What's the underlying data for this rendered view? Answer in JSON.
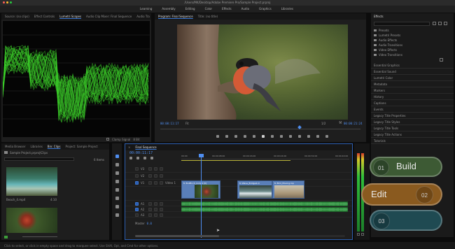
{
  "window_title": "/Users/MK/Desktop/Adobe Premiere Pro/Sample Project.prproj",
  "workspaces": [
    "Learning",
    "Assembly",
    "Editing",
    "Color",
    "Effects",
    "Audio",
    "Graphics",
    "Libraries"
  ],
  "source_tabs": [
    "Source: (no clips)",
    "Effect Controls",
    "Lumetri Scopes",
    "Audio Clip Mixer: Final Sequence",
    "Audio Tra"
  ],
  "source_active": 2,
  "scope_menu_label": "Clamp Signal",
  "scope_bit_label": "8 Bit",
  "program_tabs": [
    "Program: Final Sequence",
    "Title: (no title)"
  ],
  "program_timecode": "00:00:11:17",
  "program_fit": "Fit",
  "program_res": "1/2",
  "program_duration": "00:00:21:24",
  "project_tabs": [
    "Media Browser",
    "Libraries",
    "Bin: Clips",
    "Project: Sample Project"
  ],
  "project_active": 2,
  "project_path": "Sample Project.prproj\\Clips",
  "project_items_count": "6 Items",
  "clip1_name": "Beach_4.mp4",
  "clip1_duration": "4:10",
  "sequence_tab": "Final Sequence",
  "timeline_timecode": "00:00:11:17",
  "ruler_labels": [
    "00:00",
    "00:00:08:00",
    "00:00:16:00",
    "00:00:24:00",
    "00:00:32:00",
    "00:00:40:00"
  ],
  "tracks": [
    {
      "name": "V3",
      "label": ""
    },
    {
      "name": "V2",
      "label": ""
    },
    {
      "name": "V1",
      "label": "Video 1"
    },
    {
      "name": "A1",
      "label": ""
    },
    {
      "name": "A2",
      "label": ""
    },
    {
      "name": "A3",
      "label": ""
    }
  ],
  "master_label": "Master",
  "master_value": "0.0",
  "clip_labels": [
    "fx  Bullfinch_4.mp4 [V]",
    "fx  Wave_Bridge4.m",
    "fx  Bird_Moving.mp"
  ],
  "effects_title": "Effects",
  "effects_tree": [
    "Presets",
    "Lumetri Presets",
    "Audio Effects",
    "Audio Transitions",
    "Video Effects",
    "Video Transitions"
  ],
  "right_panels": [
    "Essential Graphics",
    "Essential Sound",
    "Lumetri Color",
    "Metadata",
    "Markers",
    "History",
    "Captions",
    "Events",
    "Legacy Title Properties",
    "Legacy Title Styles",
    "Legacy Title Tools",
    "Legacy Title Actions",
    "Tutorials"
  ],
  "status_text": "Click to select, or click in empty space and drag to marquee select. Use Shift, Opt, and Cmd for other options.",
  "overlay": {
    "build": {
      "num": "01",
      "label": "Build",
      "color": "#3d5a34"
    },
    "edit": {
      "num": "02",
      "label": "Edit",
      "color": "#8a5a1f"
    },
    "third": {
      "num": "03",
      "label": "",
      "color": "#1f4a52"
    }
  }
}
